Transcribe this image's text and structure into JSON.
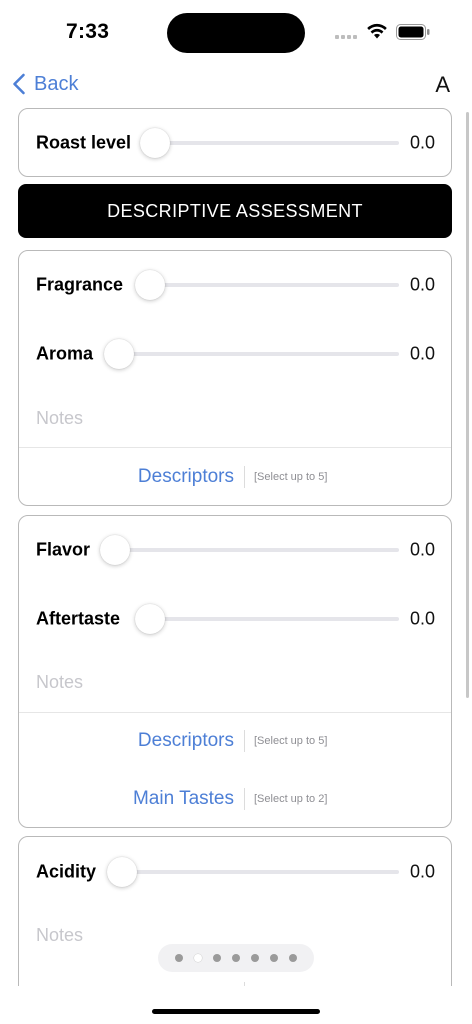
{
  "status_bar": {
    "time": "7:33"
  },
  "nav": {
    "back_label": "Back",
    "right_label": "A"
  },
  "roast": {
    "label": "Roast level",
    "value_text": "0.0",
    "value": 0.0
  },
  "section_header": "DESCRIPTIVE ASSESSMENT",
  "card_aroma": {
    "fragrance": {
      "label": "Fragrance",
      "value_text": "0.0",
      "value": 0.0
    },
    "aroma": {
      "label": "Aroma",
      "value_text": "0.0",
      "value": 0.0
    },
    "notes_placeholder": "Notes",
    "descriptors": {
      "label": "Descriptors",
      "hint": "[Select up to 5]"
    }
  },
  "card_flavor": {
    "flavor": {
      "label": "Flavor",
      "value_text": "0.0",
      "value": 0.0
    },
    "aftertaste": {
      "label": "Aftertaste",
      "value_text": "0.0",
      "value": 0.0
    },
    "notes_placeholder": "Notes",
    "descriptors": {
      "label": "Descriptors",
      "hint": "[Select up to 5]"
    },
    "main_tastes": {
      "label": "Main Tastes",
      "hint": "[Select up to 2]"
    }
  },
  "card_acidity": {
    "acidity": {
      "label": "Acidity",
      "value_text": "0.0",
      "value": 0.0
    },
    "notes_placeholder": "Notes"
  },
  "page_indicator": {
    "count": 7,
    "active_index": 1
  },
  "colors": {
    "accent": "#4d7fd6",
    "header_bg": "#000000",
    "border": "#b9b9b9",
    "placeholder": "#c7c7cc"
  }
}
